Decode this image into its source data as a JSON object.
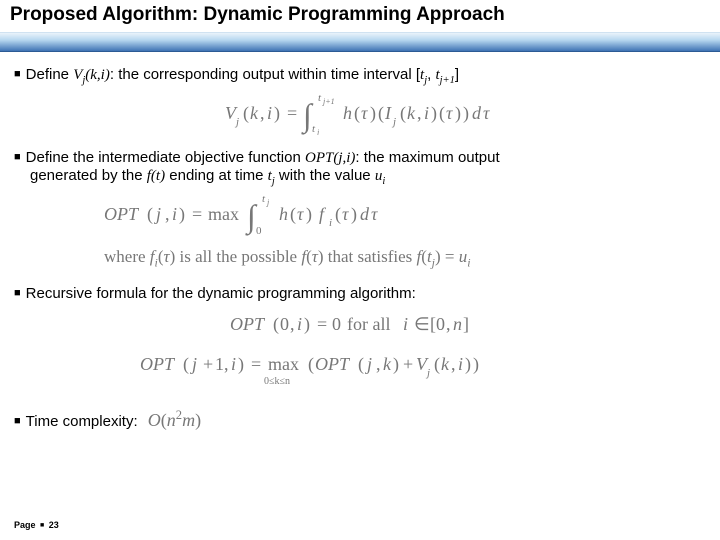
{
  "title": "Proposed Algorithm: Dynamic Programming Approach",
  "bullets": {
    "b1_pre": "Define ",
    "b1_vj": "V",
    "b1_vj_sub": "j",
    "b1_vj_args": "(k,i)",
    "b1_mid": ": the corresponding output within time interval [",
    "b1_tj_t": "t",
    "b1_tj_j": "j",
    "b1_comma": ", ",
    "b1_tj1_t": "t",
    "b1_tj1_j": "j+1",
    "b1_end": "]",
    "b2_pre": "Define the intermediate objective function ",
    "b2_opt": "OPT(j,i)",
    "b2_mid": ": the maximum output",
    "b2_line2_a": "generated by the ",
    "b2_ft": "f(t)",
    "b2_line2_b": " ending at time ",
    "b2_tj_t": "t",
    "b2_tj_j": "j",
    "b2_line2_c": " with the value ",
    "b2_ui_u": "u",
    "b2_ui_i": "i",
    "b3": "Recursive formula for the dynamic programming algorithm:",
    "b4": "Time complexity:"
  },
  "eq1": {
    "V": "V",
    "jsub": "j",
    "lp": "(",
    "k": "k",
    "comma": ",",
    "i": "i",
    "rp": ")",
    "eq": "=",
    "int": "∫",
    "low": "t",
    "low_sub": "j",
    "hi": "t",
    "hi_sub": "j+1",
    "h": "h",
    "tau": "τ",
    "rp2": ")",
    "lp3": "(",
    "I": "I",
    "jsub2": "j",
    "k2": "k",
    "i2": "i",
    "rp3": ")",
    "lp4": "(",
    "tau2": "τ",
    "rp4": ")",
    "rp5": ")",
    "d": "d",
    "tau3": "τ",
    "lp2": "("
  },
  "eq2": {
    "OPT": "OPT",
    "lp": "(",
    "j": "j",
    "comma": ",",
    "i": "i",
    "rp": ")",
    "eq": "=",
    "max": "max",
    "int": "∫",
    "zero": "0",
    "hi": "t",
    "hi_sub": "j",
    "h": "h",
    "lp2": "(",
    "tau": "τ",
    "rp2": ")",
    "f": "f",
    "isub": "i",
    "lp3": "(",
    "tau2": "τ",
    "rp3": ")",
    "d": "d",
    "tau3": "τ"
  },
  "eq2b": {
    "where": "where ",
    "f": "f",
    "isub": "i",
    "lp": "(",
    "tau": "τ",
    "rp": ")",
    "mid": " is all the possible ",
    "f2": "f",
    "lp2": "(",
    "tau2": "τ",
    "rp2": ")",
    "mid2": " that satisfies ",
    "f3": "f",
    "lp3": "(",
    "t": "t",
    "jsub": "j",
    "rp3": ")",
    "eq": "=",
    "u": "u",
    "isub2": "i"
  },
  "eq3a": {
    "OPT": "OPT",
    "lp": "(",
    "zero": "0",
    "comma": ",",
    "i": "i",
    "rp": ")",
    "eq": "=",
    "zero2": "0",
    "for": " for all ",
    "i2": "i",
    "in": "∈",
    "lb": "[",
    "zero3": "0",
    "comma2": ",",
    "n": "n",
    "rb": "]"
  },
  "eq3b": {
    "OPT": "OPT",
    "lp": "(",
    "j": "j",
    "plus": "+",
    "one": "1",
    "comma": ",",
    "i": "i",
    "rp": ")",
    "eq": "=",
    "max": "max",
    "range": "0≤k≤n",
    "lp2": "(",
    "OPT2": "OPT",
    "lp3": "(",
    "j2": "j",
    "comma2": ",",
    "k": "k",
    "rp3": ")",
    "plus2": "+",
    "V": "V",
    "jsub": "j",
    "lp4": "(",
    "k2": "k",
    "comma3": ",",
    "i2": "i",
    "rp4": ")",
    "rp2": ")"
  },
  "eq4": {
    "O": "O",
    "lp": "(",
    "n": "n",
    "sq": "2",
    "m": "m",
    "rp": ")"
  },
  "footer": {
    "page_label": "Page",
    "page_num": "23"
  }
}
